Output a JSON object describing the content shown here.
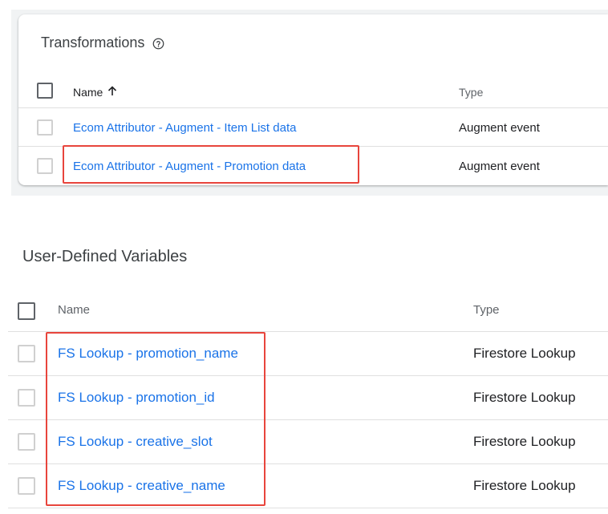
{
  "transformations": {
    "title": "Transformations",
    "header": {
      "name": "Name",
      "type": "Type",
      "sort_icon": "arrow-up-icon"
    },
    "rows": [
      {
        "name": "Ecom Attributor - Augment - Item List data",
        "type": "Augment event"
      },
      {
        "name": "Ecom Attributor - Augment - Promotion data",
        "type": "Augment event"
      }
    ]
  },
  "variables": {
    "title": "User-Defined Variables",
    "header": {
      "name": "Name",
      "type": "Type"
    },
    "rows": [
      {
        "name": "FS Lookup - promotion_name",
        "type": "Firestore Lookup"
      },
      {
        "name": "FS Lookup - promotion_id",
        "type": "Firestore Lookup"
      },
      {
        "name": "FS Lookup - creative_slot",
        "type": "Firestore Lookup"
      },
      {
        "name": "FS Lookup - creative_name",
        "type": "Firestore Lookup"
      }
    ]
  },
  "colors": {
    "link": "#1a73e8",
    "highlight": "#e8453c"
  }
}
